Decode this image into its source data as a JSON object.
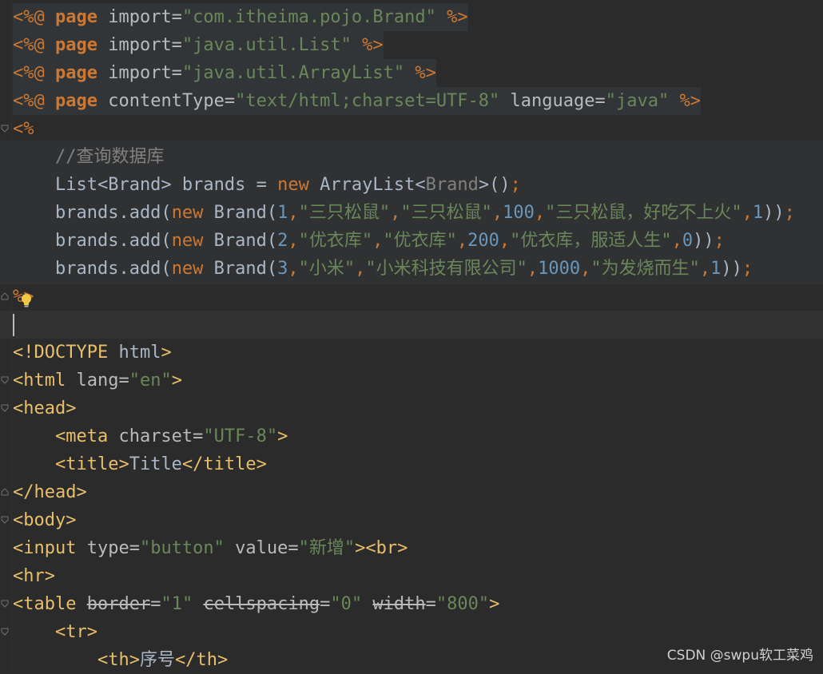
{
  "editor": {
    "lines": [
      "<%@ page import=\"com.itheima.pojo.Brand\" %>",
      "<%@ page import=\"java.util.List\" %>",
      "<%@ page import=\"java.util.ArrayList\" %>",
      "<%@ page contentType=\"text/html;charset=UTF-8\" language=\"java\" %>",
      "<%",
      "    //查询数据库",
      "    List<Brand> brands = new ArrayList<Brand>();",
      "    brands.add(new Brand(1,\"三只松鼠\",\"三只松鼠\",100,\"三只松鼠，好吃不上火\",1));",
      "    brands.add(new Brand(2,\"优衣库\",\"优衣库\",200,\"优衣库，服适人生\",0));",
      "    brands.add(new Brand(3,\"小米\",\"小米科技有限公司\",1000,\"为发烧而生\",1));",
      "%>",
      "",
      "<!DOCTYPE html>",
      "<html lang=\"en\">",
      "<head>",
      "    <meta charset=\"UTF-8\">",
      "    <title>Title</title>",
      "</head>",
      "<body>",
      "<input type=\"button\" value=\"新增\"><br>",
      "<hr>",
      "<table border=\"1\" cellspacing=\"0\" width=\"800\">",
      "    <tr>",
      "        <th>序号</th>"
    ]
  },
  "watermark": "CSDN @swpu软工菜鸡",
  "colors": {
    "background": "#2b2b2b",
    "keyword": "#cc7832",
    "string": "#6a8759",
    "number": "#6897bb",
    "tag": "#e8bf6a",
    "comment": "#808080",
    "text": "#a9b7c6"
  },
  "icons": [
    "fold-marker-icon",
    "lightbulb-icon"
  ]
}
